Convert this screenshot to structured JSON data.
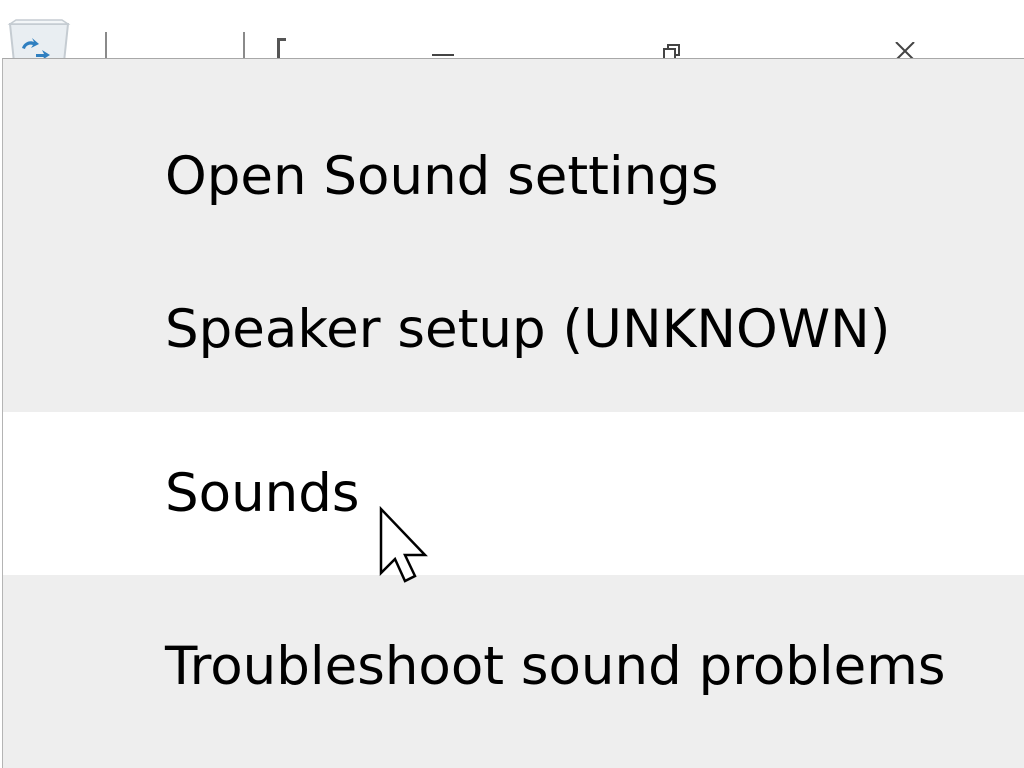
{
  "background_window": {
    "icons": {
      "recycle_bin": "recycle-bin-icon",
      "minimize": "minimize-icon",
      "restore": "restore-icon",
      "close": "close-icon"
    }
  },
  "context_menu": {
    "items": [
      {
        "label": "Open Sound settings",
        "state": "normal"
      },
      {
        "label": "Speaker setup (UNKNOWN)",
        "state": "normal"
      },
      {
        "label": "Sounds",
        "state": "hover"
      },
      {
        "label": "Troubleshoot sound problems",
        "state": "normal"
      }
    ]
  },
  "colors": {
    "menu_background": "#eeeeee",
    "hover_background": "#ffffff",
    "text": "#000000"
  },
  "pointer": {
    "icon": "arrow-cursor-icon"
  }
}
